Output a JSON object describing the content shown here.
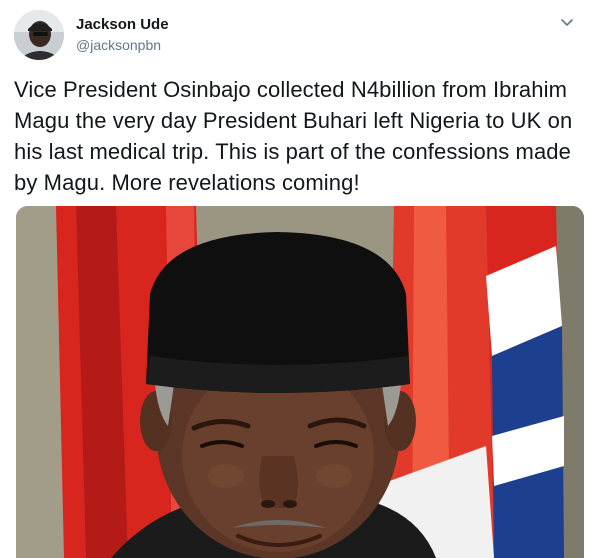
{
  "tweet": {
    "author": {
      "name": "Jackson Ude",
      "handle": "@jacksonpbn"
    },
    "text": "Vice President Osinbajo collected N4billion from Ibrahim Magu the very day President Buhari left Nigeria to UK on his last medical trip. This is part of the confessions made by Magu. More revelations coming!",
    "icons": {
      "more": "chevron-down-icon",
      "avatar": "profile-photo"
    },
    "colors": {
      "name": "#14171a",
      "handle": "#657786",
      "text": "#14171a"
    }
  }
}
